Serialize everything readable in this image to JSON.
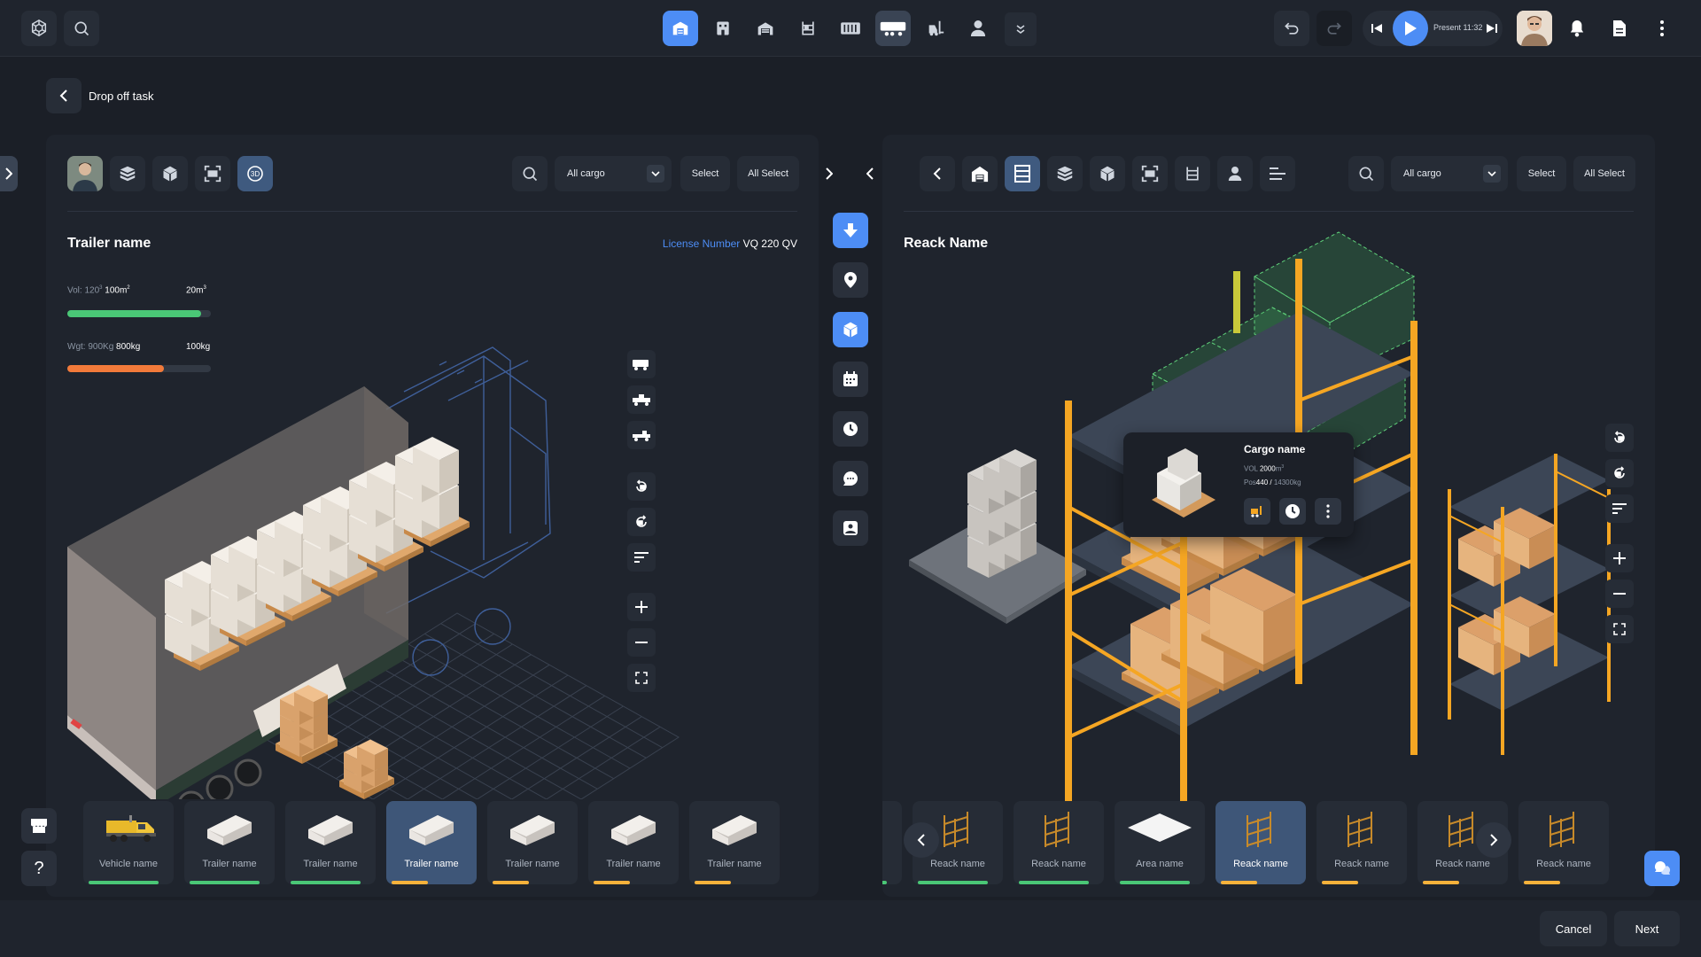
{
  "topbar": {
    "present_label": "Present 11:32"
  },
  "page": {
    "back_label": "Drop off task"
  },
  "left_panel": {
    "dropdown_value": "All cargo",
    "select_label": "Select",
    "all_select_label": "All Select",
    "title": "Trailer name",
    "license_label": "License Number",
    "license_value": "VQ 220 QV",
    "volume": {
      "label": "Vol: 120",
      "sup": "3",
      "value": "100m",
      "value_sup": "2",
      "max": "20m",
      "max_sup": "3",
      "percent": 93,
      "color": "#4ac776"
    },
    "weight": {
      "label": "Wgt: 900Kg",
      "value": "800kg",
      "max": "100kg",
      "percent": 67,
      "color": "#f27a3a"
    },
    "cards": [
      {
        "label": "Vehicle name",
        "bar_color": "#4ac776",
        "bar_pct": 88,
        "type": "truck"
      },
      {
        "label": "Trailer name",
        "bar_color": "#4ac776",
        "bar_pct": 88,
        "type": "trailer"
      },
      {
        "label": "Trailer name",
        "bar_color": "#4ac776",
        "bar_pct": 88,
        "type": "trailer"
      },
      {
        "label": "Trailer name",
        "bar_color": "#f7b23b",
        "bar_pct": 45,
        "type": "trailer",
        "selected": true
      },
      {
        "label": "Trailer name",
        "bar_color": "#f7b23b",
        "bar_pct": 45,
        "type": "trailer"
      },
      {
        "label": "Trailer name",
        "bar_color": "#f7b23b",
        "bar_pct": 45,
        "type": "trailer"
      },
      {
        "label": "Trailer name",
        "bar_color": "#f7b23b",
        "bar_pct": 45,
        "type": "trailer"
      }
    ]
  },
  "right_panel": {
    "dropdown_value": "All cargo",
    "select_label": "Select",
    "all_select_label": "All Select",
    "title": "Reack Name",
    "tooltip": {
      "title": "Cargo name",
      "vol_label": "VOL",
      "vol_value": "2000",
      "vol_unit": "m",
      "vol_sup": "3",
      "pos_label": "Pos",
      "pos_value": "440",
      "pos_sep": " / ",
      "pos_max": "14300",
      "pos_unit": "kg"
    },
    "cards": [
      {
        "label": "ne",
        "bar_color": "#4ac776",
        "type": "rack",
        "partial": true
      },
      {
        "label": "Reack name",
        "bar_color": "#4ac776",
        "type": "rack"
      },
      {
        "label": "Reack name",
        "bar_color": "#4ac776",
        "type": "rack"
      },
      {
        "label": "Area name",
        "bar_color": "#4ac776",
        "type": "area"
      },
      {
        "label": "Reack name",
        "bar_color": "#f7b23b",
        "bar_pct": 45,
        "type": "rack",
        "selected": true
      },
      {
        "label": "Reack name",
        "bar_color": "#f7b23b",
        "bar_pct": 45,
        "type": "rack"
      },
      {
        "label": "Reack name",
        "bar_color": "#f7b23b",
        "bar_pct": 45,
        "type": "rack"
      },
      {
        "label": "Reack name",
        "bar_color": "#f7b23b",
        "bar_pct": 45,
        "type": "rack"
      }
    ]
  },
  "footer": {
    "cancel_label": "Cancel",
    "next_label": "Next"
  },
  "colors": {
    "accent": "#4d8df5",
    "rack": "#f5a623",
    "box": "#e0a86c"
  }
}
